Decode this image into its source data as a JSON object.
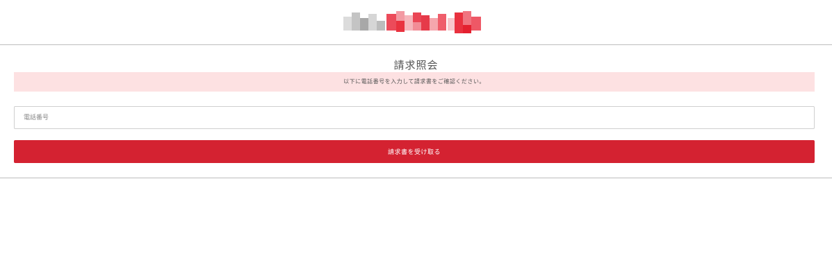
{
  "header": {
    "logo_icon": "pixelated-logo-image",
    "logo_colors": [
      "#c8c8c8",
      "#a9a9a9",
      "#e84a5f",
      "#f07d8a",
      "#e5323f"
    ]
  },
  "main": {
    "title": "請求照会",
    "notice": "以下に電話番号を入力して請求書をご確認ください。",
    "phone_placeholder": "電話番号",
    "phone_value": "",
    "submit_label": "請求書を受け取る"
  },
  "colors": {
    "accent": "#d42231",
    "notice_bg": "#fde1e2"
  }
}
